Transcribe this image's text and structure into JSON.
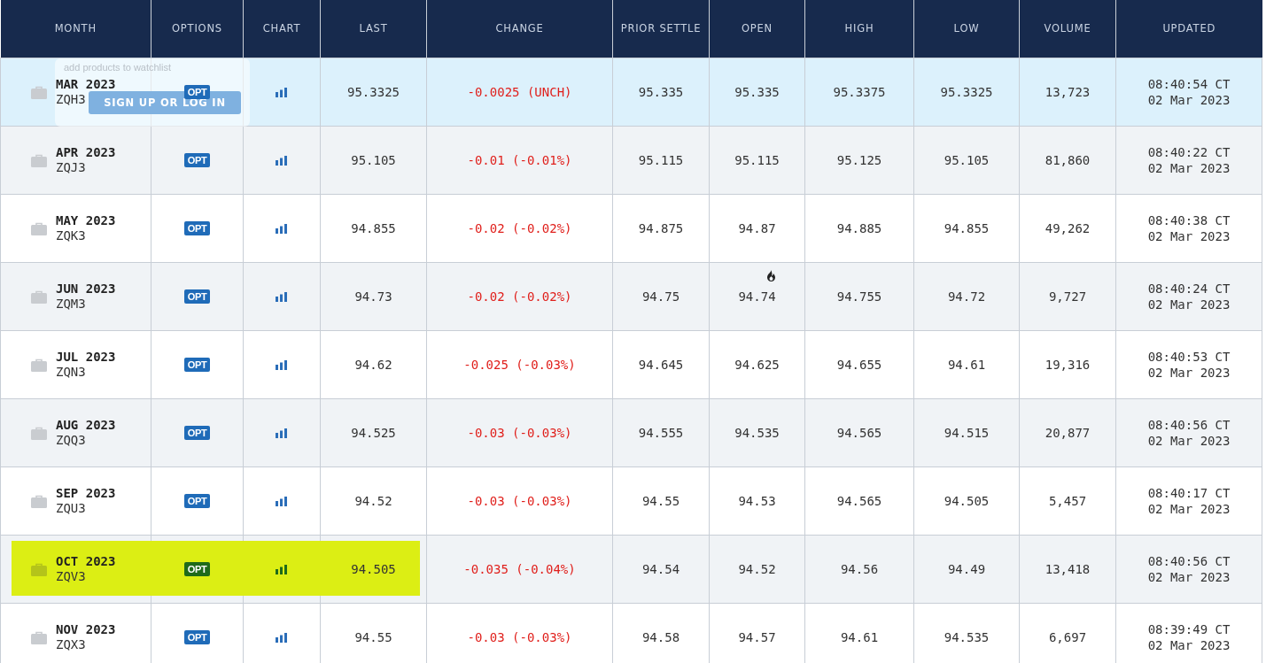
{
  "columns": [
    "MONTH",
    "OPTIONS",
    "CHART",
    "LAST",
    "CHANGE",
    "PRIOR SETTLE",
    "OPEN",
    "HIGH",
    "LOW",
    "VOLUME",
    "UPDATED"
  ],
  "popup": {
    "text": "add products to watchlist",
    "button": "SIGN UP OR LOG IN"
  },
  "rows": [
    {
      "month": "MAR 2023",
      "code": "ZQH3",
      "options": "OPT",
      "last": "95.3325",
      "change": "-0.0025 (UNCH)",
      "prior_settle": "95.335",
      "open": "95.335",
      "open_hot": false,
      "high": "95.3375",
      "low": "95.3325",
      "volume": "13,723",
      "time": "08:40:54 CT",
      "date": "02 Mar 2023",
      "hovered": true,
      "highlighted": false
    },
    {
      "month": "APR 2023",
      "code": "ZQJ3",
      "options": "OPT",
      "last": "95.105",
      "change": "-0.01 (-0.01%)",
      "prior_settle": "95.115",
      "open": "95.115",
      "open_hot": false,
      "high": "95.125",
      "low": "95.105",
      "volume": "81,860",
      "time": "08:40:22 CT",
      "date": "02 Mar 2023",
      "hovered": false,
      "highlighted": false
    },
    {
      "month": "MAY 2023",
      "code": "ZQK3",
      "options": "OPT",
      "last": "94.855",
      "change": "-0.02 (-0.02%)",
      "prior_settle": "94.875",
      "open": "94.87",
      "open_hot": false,
      "high": "94.885",
      "low": "94.855",
      "volume": "49,262",
      "time": "08:40:38 CT",
      "date": "02 Mar 2023",
      "hovered": false,
      "highlighted": false
    },
    {
      "month": "JUN 2023",
      "code": "ZQM3",
      "options": "OPT",
      "last": "94.73",
      "change": "-0.02 (-0.02%)",
      "prior_settle": "94.75",
      "open": "94.74",
      "open_hot": true,
      "high": "94.755",
      "low": "94.72",
      "volume": "9,727",
      "time": "08:40:24 CT",
      "date": "02 Mar 2023",
      "hovered": false,
      "highlighted": false
    },
    {
      "month": "JUL 2023",
      "code": "ZQN3",
      "options": "OPT",
      "last": "94.62",
      "change": "-0.025 (-0.03%)",
      "prior_settle": "94.645",
      "open": "94.625",
      "open_hot": false,
      "high": "94.655",
      "low": "94.61",
      "volume": "19,316",
      "time": "08:40:53 CT",
      "date": "02 Mar 2023",
      "hovered": false,
      "highlighted": false
    },
    {
      "month": "AUG 2023",
      "code": "ZQQ3",
      "options": "OPT",
      "last": "94.525",
      "change": "-0.03 (-0.03%)",
      "prior_settle": "94.555",
      "open": "94.535",
      "open_hot": false,
      "high": "94.565",
      "low": "94.515",
      "volume": "20,877",
      "time": "08:40:56 CT",
      "date": "02 Mar 2023",
      "hovered": false,
      "highlighted": false
    },
    {
      "month": "SEP 2023",
      "code": "ZQU3",
      "options": "OPT",
      "last": "94.52",
      "change": "-0.03 (-0.03%)",
      "prior_settle": "94.55",
      "open": "94.53",
      "open_hot": false,
      "high": "94.565",
      "low": "94.505",
      "volume": "5,457",
      "time": "08:40:17 CT",
      "date": "02 Mar 2023",
      "hovered": false,
      "highlighted": false
    },
    {
      "month": "OCT 2023",
      "code": "ZQV3",
      "options": "OPT",
      "last": "94.505",
      "change": "-0.035 (-0.04%)",
      "prior_settle": "94.54",
      "open": "94.52",
      "open_hot": false,
      "high": "94.56",
      "low": "94.49",
      "volume": "13,418",
      "time": "08:40:56 CT",
      "date": "02 Mar 2023",
      "hovered": false,
      "highlighted": true
    },
    {
      "month": "NOV 2023",
      "code": "ZQX3",
      "options": "OPT",
      "last": "94.55",
      "change": "-0.03 (-0.03%)",
      "prior_settle": "94.58",
      "open": "94.57",
      "open_hot": false,
      "high": "94.61",
      "low": "94.535",
      "volume": "6,697",
      "time": "08:39:49 CT",
      "date": "02 Mar 2023",
      "hovered": false,
      "highlighted": false
    }
  ]
}
